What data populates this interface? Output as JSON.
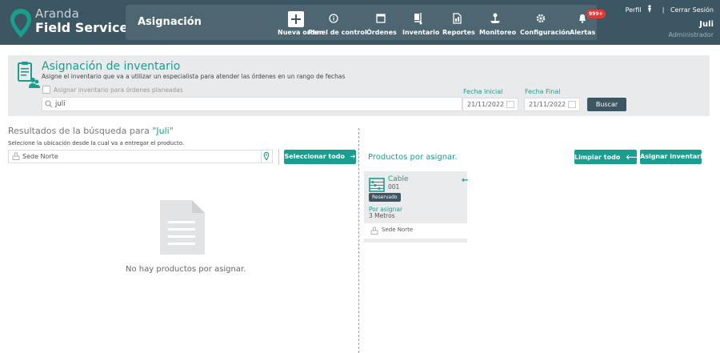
{
  "brand": {
    "line1": "Aranda",
    "line2": "Field Service"
  },
  "header": {
    "section_title": "Asignación",
    "nav": [
      {
        "label": "Nueva orden",
        "icon": "plus-icon"
      },
      {
        "label": "Panel de control",
        "icon": "info-icon"
      },
      {
        "label": "Órdenes",
        "icon": "window-icon"
      },
      {
        "label": "Inventario",
        "icon": "dolly-icon"
      },
      {
        "label": "Reportes",
        "icon": "report-icon"
      },
      {
        "label": "Monitoreo",
        "icon": "monitor-icon"
      },
      {
        "label": "Configuración",
        "icon": "gear-icon"
      },
      {
        "label": "Alertas",
        "icon": "bell-icon"
      }
    ],
    "alert_badge": "999+",
    "profile": "Perfil",
    "separator": "|",
    "logout": "Cerrar Sesión",
    "user_name": "Juli",
    "user_role": "Administrador"
  },
  "panel": {
    "title": "Asignación de inventario",
    "subtitle": "Asigne el inventario que va a utilizar un especialista para atender las órdenes en un rango de fechas",
    "checkbox_label": "Asignar inventario para órdenes planeadas",
    "search_value": "juli",
    "fecha_inicial_label": "Fecha Inicial",
    "fecha_inicial": "21/11/2022",
    "fecha_final_label": "Fecha Final",
    "fecha_final": "21/11/2022",
    "search_button": "Buscar"
  },
  "results": {
    "title_prefix": "Resultados de la búsqueda para ",
    "query": "\"Juli\"",
    "location_hint": "Selecione la ubicación desde la cual va a entregar el producto.",
    "location_value": "Sede Norte",
    "select_all_button": "Seleccionar todo",
    "empty_message": "No hay productos por asignar."
  },
  "products": {
    "title": "Productos por asignar.",
    "clear_button": "Limpiar todo",
    "assign_button": "Asignar inventario",
    "items": [
      {
        "name": "Cable",
        "code": "001",
        "status": "Reservado",
        "por_label": "Por asignar",
        "qty": "3 Metros",
        "location": "Sede Norte"
      }
    ]
  },
  "colors": {
    "teal": "#1a9e8f",
    "header": "#3d5663",
    "badge": "#e53935"
  }
}
